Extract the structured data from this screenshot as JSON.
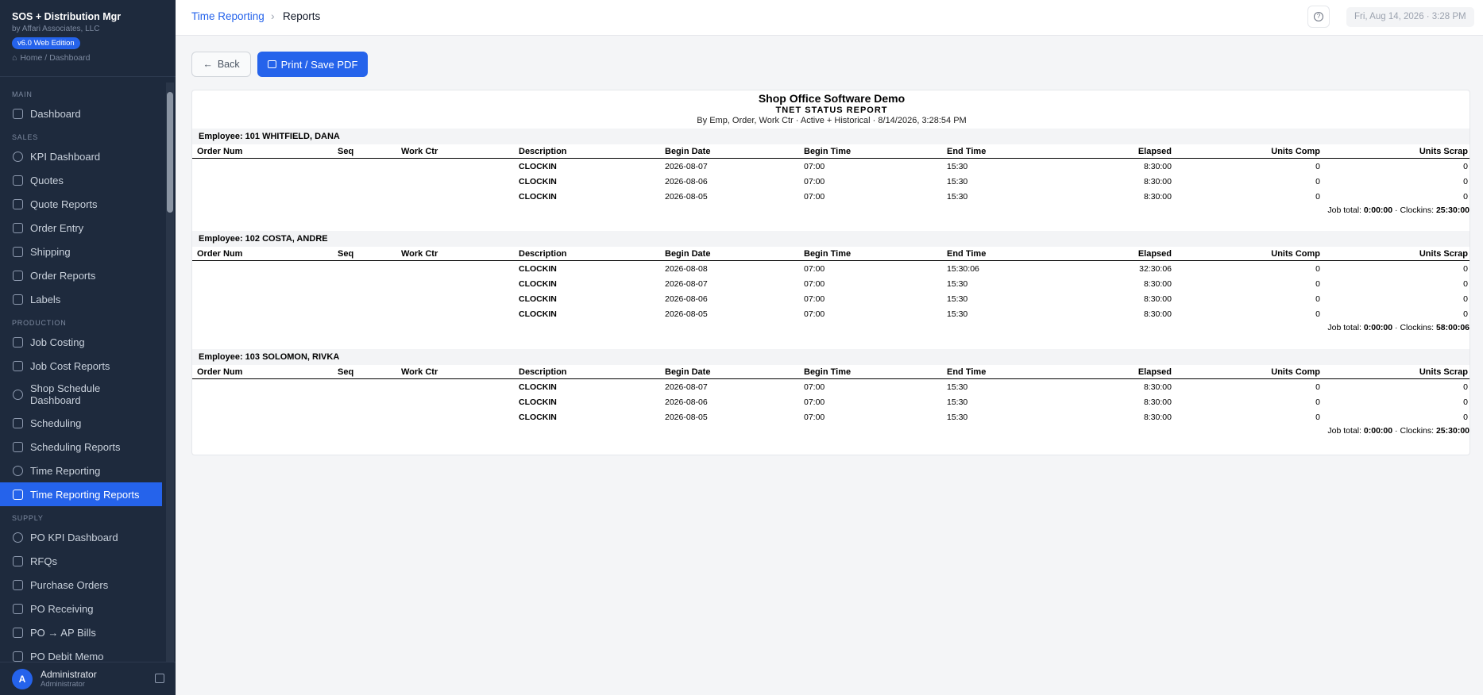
{
  "app": {
    "title": "SOS + Distribution Mgr",
    "company": "by Affari Associates, LLC",
    "edition": "v6.0 Web Edition",
    "breadcrumb": "Home / Dashboard"
  },
  "sidebar": {
    "sections": {
      "main": "MAIN",
      "sales": "SALES",
      "production": "PRODUCTION",
      "supply": "SUPPLY"
    },
    "items": {
      "dashboard": "Dashboard",
      "kpi_dashboard": "KPI Dashboard",
      "quotes": "Quotes",
      "quote_reports": "Quote Reports",
      "order_entry": "Order Entry",
      "shipping": "Shipping",
      "order_reports": "Order Reports",
      "labels": "Labels",
      "job_costing": "Job Costing",
      "job_cost_reports": "Job Cost Reports",
      "shop_schedule_1": "Shop Schedule",
      "shop_schedule_2": "Dashboard",
      "scheduling": "Scheduling",
      "scheduling_reports": "Scheduling Reports",
      "time_reporting": "Time Reporting",
      "time_reporting_reports": "Time Reporting Reports",
      "po_kpi_dashboard": "PO KPI Dashboard",
      "rfqs": "RFQs",
      "purchase_orders": "Purchase Orders",
      "po_receiving": "PO Receiving",
      "po_ap_bills": "PO → AP Bills",
      "po_debit_memo": "PO Debit Memo"
    },
    "user": {
      "initial": "A",
      "name": "Administrator",
      "role": "Administrator"
    }
  },
  "topbar": {
    "crumb_link": "Time Reporting",
    "crumb_sep": "›",
    "crumb_current": "Reports",
    "help": "?",
    "datetime": "Fri, Aug 14, 2026 · 3:28 PM"
  },
  "actions": {
    "back": "Back",
    "back_arrow": "←",
    "print": "Print / Save PDF"
  },
  "report": {
    "company": "Shop Office Software Demo",
    "title": "TNET STATUS REPORT",
    "meta": "By Emp, Order, Work Ctr · Active + Historical · 8/14/2026, 3:28:54 PM",
    "columns": {
      "order_num": "Order Num",
      "seq": "Seq",
      "work_ctr": "Work Ctr",
      "description": "Description",
      "begin_date": "Begin Date",
      "begin_time": "Begin Time",
      "end_time": "End Time",
      "elapsed": "Elapsed",
      "units_comp": "Units Comp",
      "units_scrap": "Units Scrap"
    },
    "total_labels": {
      "job_total": "Job total:",
      "clockins": "· Clockins:"
    },
    "employees": [
      {
        "label": "Employee: 101 WHITFIELD, DANA",
        "rows": [
          {
            "description": "CLOCKIN",
            "begin_date": "2026-08-07",
            "begin_time": "07:00",
            "end_time": "15:30",
            "elapsed": "8:30:00",
            "units_comp": "0",
            "units_scrap": "0"
          },
          {
            "description": "CLOCKIN",
            "begin_date": "2026-08-06",
            "begin_time": "07:00",
            "end_time": "15:30",
            "elapsed": "8:30:00",
            "units_comp": "0",
            "units_scrap": "0"
          },
          {
            "description": "CLOCKIN",
            "begin_date": "2026-08-05",
            "begin_time": "07:00",
            "end_time": "15:30",
            "elapsed": "8:30:00",
            "units_comp": "0",
            "units_scrap": "0"
          }
        ],
        "job_total": "0:00:00",
        "clockins": "25:30:00"
      },
      {
        "label": "Employee: 102 COSTA, ANDRE",
        "rows": [
          {
            "description": "CLOCKIN",
            "begin_date": "2026-08-08",
            "begin_time": "07:00",
            "end_time": "15:30:06",
            "elapsed": "32:30:06",
            "units_comp": "0",
            "units_scrap": "0"
          },
          {
            "description": "CLOCKIN",
            "begin_date": "2026-08-07",
            "begin_time": "07:00",
            "end_time": "15:30",
            "elapsed": "8:30:00",
            "units_comp": "0",
            "units_scrap": "0"
          },
          {
            "description": "CLOCKIN",
            "begin_date": "2026-08-06",
            "begin_time": "07:00",
            "end_time": "15:30",
            "elapsed": "8:30:00",
            "units_comp": "0",
            "units_scrap": "0"
          },
          {
            "description": "CLOCKIN",
            "begin_date": "2026-08-05",
            "begin_time": "07:00",
            "end_time": "15:30",
            "elapsed": "8:30:00",
            "units_comp": "0",
            "units_scrap": "0"
          }
        ],
        "job_total": "0:00:00",
        "clockins": "58:00:06"
      },
      {
        "label": "Employee: 103 SOLOMON, RIVKA",
        "rows": [
          {
            "description": "CLOCKIN",
            "begin_date": "2026-08-07",
            "begin_time": "07:00",
            "end_time": "15:30",
            "elapsed": "8:30:00",
            "units_comp": "0",
            "units_scrap": "0"
          },
          {
            "description": "CLOCKIN",
            "begin_date": "2026-08-06",
            "begin_time": "07:00",
            "end_time": "15:30",
            "elapsed": "8:30:00",
            "units_comp": "0",
            "units_scrap": "0"
          },
          {
            "description": "CLOCKIN",
            "begin_date": "2026-08-05",
            "begin_time": "07:00",
            "end_time": "15:30",
            "elapsed": "8:30:00",
            "units_comp": "0",
            "units_scrap": "0"
          }
        ],
        "job_total": "0:00:00",
        "clockins": "25:30:00"
      }
    ]
  },
  "colors": {
    "sidebar_bg": "#1e2a3d",
    "accent": "#2563eb"
  }
}
